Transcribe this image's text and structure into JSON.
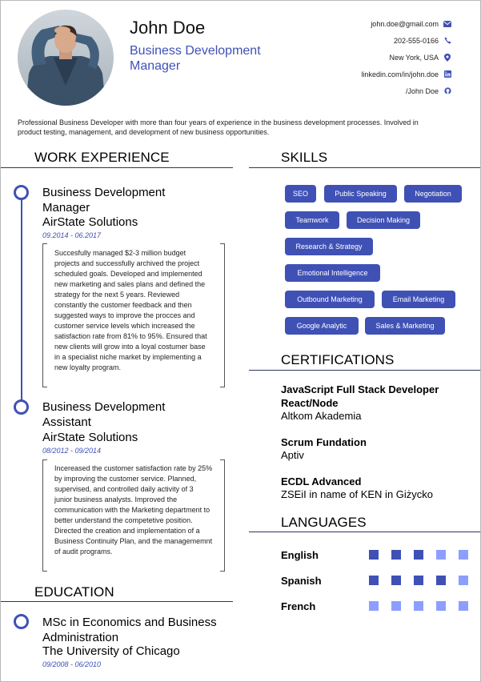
{
  "header": {
    "name": "John Doe",
    "title": "Business Development Manager",
    "contacts": [
      {
        "text": "john.doe@gmail.com",
        "icon": "envelope-icon"
      },
      {
        "text": "202-555-0166",
        "icon": "phone-icon"
      },
      {
        "text": "New York, USA",
        "icon": "map-pin-icon"
      },
      {
        "text": "linkedin.com/in/john.doe",
        "icon": "linkedin-icon"
      },
      {
        "text": "/John Doe",
        "icon": "github-icon"
      }
    ],
    "summary": "Professional Business Developer with more than four years of experience in the business development processes. Involved in product testing, management, and development of new business opportunities."
  },
  "sections": {
    "work": "WORK EXPERIENCE",
    "education": "EDUCATION",
    "skills": "SKILLS",
    "certifications": "CERTIFICATIONS",
    "languages": "LANGUAGES"
  },
  "work": [
    {
      "role": "Business Development Manager",
      "company": "AirState Solutions",
      "dates": "09.2014 - 06.2017",
      "description": "Succesfully managed $2-3 million budget projects and successfully archived the project scheduled goals. Developed and implemented new marketing and sales plans and defined the strategy for the next 5 years. Reviewed constantly the customer feedback and then suggested ways to improve the procces and customer service levels which increased the satisfaction rate from 81% to 95%. Ensured that new clients will grow into a loyal costumer base in a specialist niche market by implementing a new loyalty program."
    },
    {
      "role": "Business Development Assistant",
      "company": "AirState Solutions",
      "dates": "08/2012 - 09/2014",
      "description": "Incereased the customer satisfaction rate by 25% by improving the customer service. Planned, supervised, and controlled daily activity of 3 junior business analysts. Improved the communication with the Marketing department to better understand the competetive position. Directed the creation and implementation of a Business Continuity Plan, and the managememnt of audit programs."
    }
  ],
  "education": [
    {
      "degree": "MSc in Economics and Business Administration",
      "school": "The University of Chicago",
      "dates": "09/2008 - 06/2010"
    }
  ],
  "skills": [
    [
      "SEO",
      "Public Speaking",
      "Negotiation"
    ],
    [
      "Teamwork",
      "Decision Making"
    ],
    [
      "Research & Strategy"
    ],
    [
      "Emotional Intelligence"
    ],
    [
      "Outbound Marketing",
      "Email Marketing"
    ],
    [
      "Google Analytic",
      "Sales & Marketing"
    ]
  ],
  "certifications": [
    {
      "title": "JavaScript Full Stack Developer React/Node",
      "org": "Altkom Akademia"
    },
    {
      "title": "Scrum Fundation",
      "org": "Aptiv"
    },
    {
      "title": "ECDL Advanced",
      "org": "ZSEiI in name of KEN in Giżycko"
    }
  ],
  "languages": [
    {
      "name": "English",
      "level": 3,
      "max": 5
    },
    {
      "name": "Spanish",
      "level": 4,
      "max": 5
    },
    {
      "name": "French",
      "level": 0,
      "max": 5
    }
  ],
  "colors": {
    "accent": "#3f51b5",
    "accent_light": "#8c9eff",
    "line": "#2d3561"
  }
}
